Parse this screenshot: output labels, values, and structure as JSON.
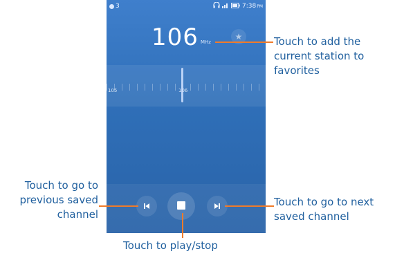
{
  "status_bar": {
    "left_text": "3",
    "right_icons": [
      "headphones-icon",
      "signal-icon",
      "battery-icon"
    ],
    "time": "7:38",
    "ampm": "PM"
  },
  "radio": {
    "frequency": "106",
    "unit": "MHz",
    "tuner_labels": [
      "105",
      "106"
    ]
  },
  "annotations": {
    "favorite": "Touch to add the current station to favorites",
    "previous": "Touch to go to previous saved channel",
    "next": "Touch to go to next saved channel",
    "play_stop": "Touch to play/stop"
  },
  "colors": {
    "screen_top": "#3f7fcc",
    "screen_bottom": "#2a63a8",
    "annotation_text": "#1f5f9e",
    "leader_line": "#f07b2a"
  }
}
